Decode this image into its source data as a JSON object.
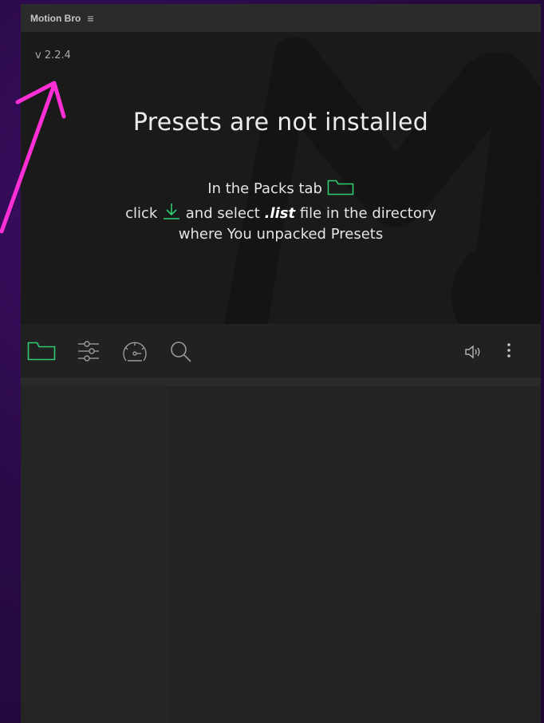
{
  "app": {
    "title": "Motion Bro",
    "menu_icon": "hamburger-icon",
    "version": "v 2.2.4"
  },
  "hero": {
    "title": "Presets are not installed",
    "line1_prefix": "In the Packs tab",
    "line2_prefix": "click",
    "line2_mid": "and select",
    "line2_bold": ".list",
    "line2_suffix": "file in the directory",
    "line3": "where You unpacked Presets"
  },
  "toolbar": {
    "items": [
      {
        "icon": "folder-icon",
        "active": true
      },
      {
        "icon": "sliders-icon",
        "active": false
      },
      {
        "icon": "speedometer-icon",
        "active": false
      },
      {
        "icon": "search-icon",
        "active": false
      },
      {
        "icon": "speaker-icon",
        "active": false
      },
      {
        "icon": "more-vertical-icon",
        "active": false
      }
    ]
  },
  "colors": {
    "accent": "#2ecc71",
    "annotation": "#ff2fd6",
    "background": "#2b0a47",
    "panel": "#1c1c1c"
  }
}
